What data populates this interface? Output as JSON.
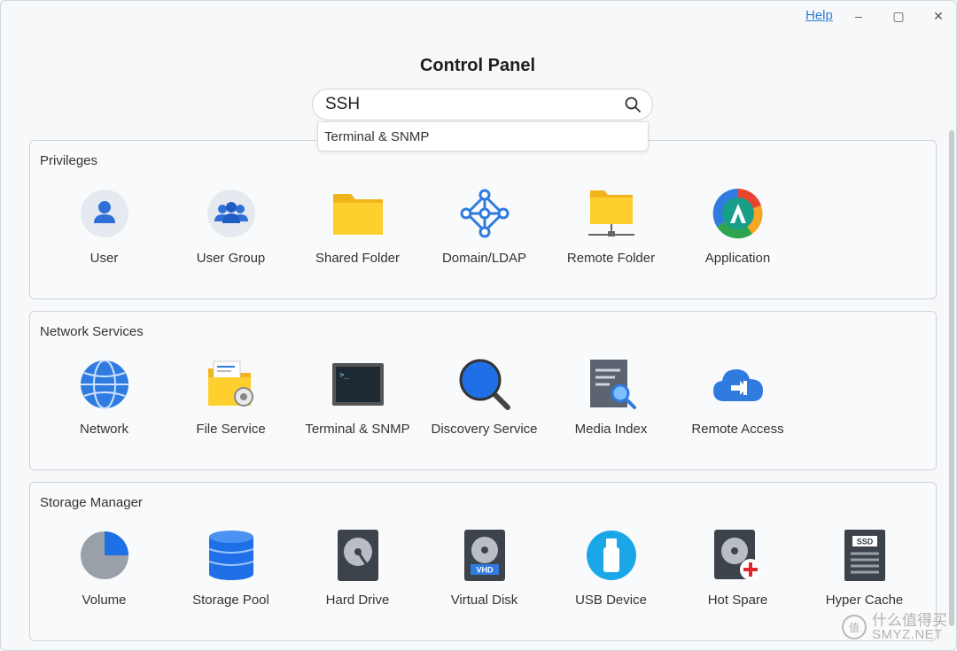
{
  "window": {
    "help_label": "Help",
    "minimize_glyph": "–",
    "maximize_glyph": "▢",
    "close_glyph": "✕"
  },
  "page": {
    "title": "Control Panel"
  },
  "search": {
    "value": "SSH",
    "placeholder": "",
    "suggestion": "Terminal & SNMP"
  },
  "sections": [
    {
      "title": "Privileges",
      "items": [
        {
          "label": "User",
          "icon": "user-icon"
        },
        {
          "label": "User Group",
          "icon": "user-group-icon"
        },
        {
          "label": "Shared Folder",
          "icon": "shared-folder-icon"
        },
        {
          "label": "Domain/LDAP",
          "icon": "domain-ldap-icon"
        },
        {
          "label": "Remote Folder",
          "icon": "remote-folder-icon"
        },
        {
          "label": "Application",
          "icon": "application-icon"
        }
      ]
    },
    {
      "title": "Network Services",
      "items": [
        {
          "label": "Network",
          "icon": "network-globe-icon"
        },
        {
          "label": "File Service",
          "icon": "file-service-icon"
        },
        {
          "label": "Terminal & SNMP",
          "icon": "terminal-icon"
        },
        {
          "label": "Discovery Service",
          "icon": "discovery-magnifier-icon"
        },
        {
          "label": "Media Index",
          "icon": "media-index-icon"
        },
        {
          "label": "Remote Access",
          "icon": "remote-access-cloud-icon"
        }
      ]
    },
    {
      "title": "Storage Manager",
      "items": [
        {
          "label": "Volume",
          "icon": "volume-pie-icon"
        },
        {
          "label": "Storage Pool",
          "icon": "storage-pool-icon"
        },
        {
          "label": "Hard Drive",
          "icon": "hard-drive-icon"
        },
        {
          "label": "Virtual Disk",
          "icon": "virtual-disk-icon"
        },
        {
          "label": "USB Device",
          "icon": "usb-device-icon"
        },
        {
          "label": "Hot Spare",
          "icon": "hot-spare-icon"
        },
        {
          "label": "Hyper Cache",
          "icon": "hyper-cache-ssd-icon"
        }
      ]
    }
  ],
  "watermark": {
    "brand": "什么值得买",
    "site": "SMYZ.NET",
    "logo": "值"
  }
}
